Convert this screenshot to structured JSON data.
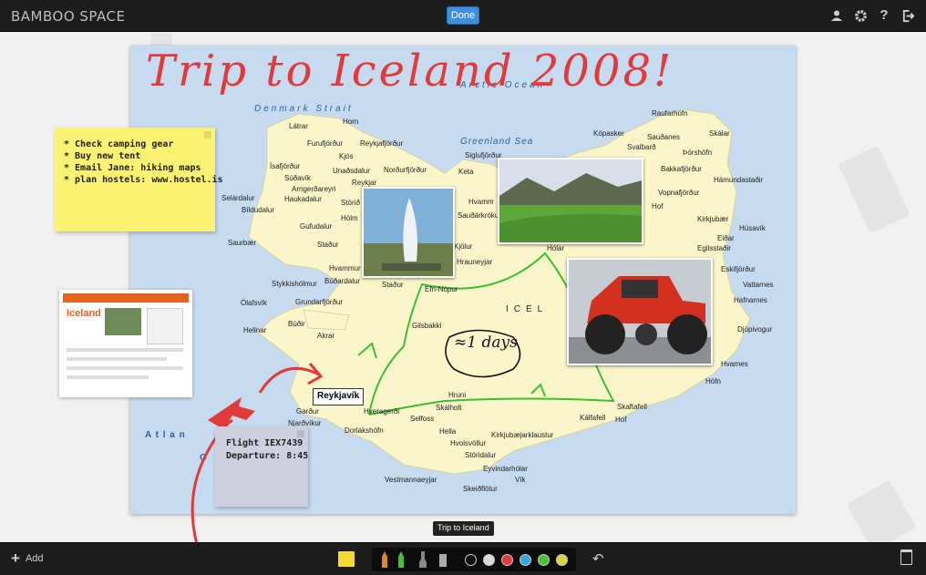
{
  "app": {
    "name": "BAMBOO SPACE"
  },
  "header": {
    "done_label": "Done"
  },
  "top_icons": [
    "user-icon",
    "gear-icon",
    "help-icon",
    "logout-icon"
  ],
  "board": {
    "title_scribble": "Trip to Iceland 2008!",
    "notes": {
      "todo": [
        "* Check camping gear",
        "* Buy new tent",
        "* Email Jane: hiking maps",
        "* plan hostels: www.hostel.is"
      ],
      "flight": [
        "Flight IEX7439",
        "Departure: 8:45"
      ]
    },
    "days_scribble": "≈1 days",
    "webpage_title": "Iceland",
    "location_label": "Reykjavík",
    "tooltip": "Trip to Iceland"
  },
  "map": {
    "seas": [
      "Arctic Ocean",
      "Denmark Strait",
      "Greenland Sea",
      "ICEL",
      "A t l a n",
      "O"
    ],
    "places": [
      "Horn",
      "Látrar",
      "Furufjörður",
      "Reykjafjörður",
      "Kjós",
      "Ísafjörður",
      "Súðavík",
      "Arngerðareyri",
      "Haukadalur",
      "Selárdalur",
      "Bíldudalur",
      "Norðurfjörður",
      "Unaðsdalur",
      "Reykjar",
      "Stórið",
      "Hólm",
      "Gufudalur",
      "Staður",
      "Saurbær",
      "Stykkishólmur",
      "Búðardalur",
      "Hvammur",
      "Grundarfjörður",
      "Ólafsvík",
      "Búðir",
      "Hellnar",
      "Akrar",
      "Staður",
      "Efri-Núpur",
      "Gilsbakki",
      "Hólar",
      "Keta",
      "Hvamm",
      "Siglufjörður",
      "Sauðárkrókur",
      "Kópasker",
      "Raufarhöfn",
      "Sauðanes",
      "Skálar",
      "Svalbarð",
      "Þórshöfn",
      "Bakkafjörður",
      "Hámundastaðir",
      "Vopnafjörður",
      "Hof",
      "Kirkjubær",
      "Húsavík",
      "Eiðar",
      "Egilsstaðir",
      "Eskifjörður",
      "Vattarnes",
      "Hafnarnes",
      "Djúpivogur",
      "Höfn",
      "Hvarnes",
      "Skaftafell",
      "Kálfafell",
      "Hof",
      "Garður",
      "Njarðvíkur",
      "Hveragerði",
      "Selfoss",
      "Skálholt",
      "Hruni",
      "Hella",
      "Hvolsvöllur",
      "Stóridalur",
      "Kirkjubæjarklaustur",
      "Eyvindarhólar",
      "Vík",
      "Skeiðflötur",
      "Vestmannaeyjar",
      "Dorlákshöfn",
      "Kjölur",
      "Hrauneyjar"
    ]
  },
  "toolbar": {
    "add_label": "Add",
    "colors": [
      "#111111",
      "#d9d9d9",
      "#e03b3b",
      "#37a7e0",
      "#4cbf3c",
      "#d8d43a"
    ]
  }
}
